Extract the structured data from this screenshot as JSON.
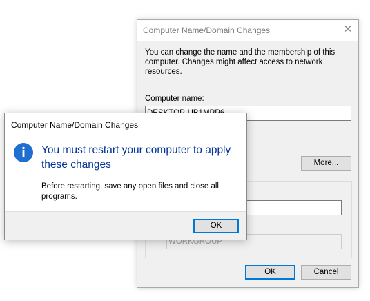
{
  "background_dialog": {
    "title": "Computer Name/Domain Changes",
    "close_symbol": "✕",
    "description": "You can change the name and the membership of this computer. Changes might affect access to network resources.",
    "computer_name_label": "Computer name:",
    "computer_name_value": "DESKTOP-UB1MPP6",
    "more_button": "More...",
    "workgroup_value": "WORKGROUP",
    "ok_button": "OK",
    "cancel_button": "Cancel"
  },
  "message_box": {
    "title": "Computer Name/Domain Changes",
    "icon": "info-icon",
    "heading": "You must restart your computer to apply these changes",
    "body": "Before restarting, save any open files and close all programs.",
    "ok_button": "OK"
  },
  "colors": {
    "accent": "#0078d7",
    "heading_text": "#003399",
    "dialog_background": "#f0f0f0"
  }
}
